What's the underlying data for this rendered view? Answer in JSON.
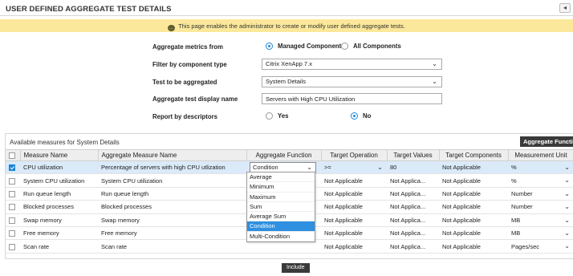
{
  "header": {
    "title": "USER DEFINED AGGREGATE TEST DETAILS",
    "back_glyph": "◂"
  },
  "info": {
    "message": "This page enables the administrator to create or modify user defined aggregate tests."
  },
  "form": {
    "metrics_label": "Aggregate metrics from",
    "metrics_options": [
      "Managed Components",
      "All Components"
    ],
    "metrics_selected": "Managed Components",
    "filter_label": "Filter by component type",
    "filter_value": "Citrix XenApp 7.x",
    "test_label": "Test to be aggregated",
    "test_value": "System Details",
    "display_name_label": "Aggregate test display name",
    "display_name_value": "Servers with High CPU Utilization",
    "descriptors_label": "Report by descriptors",
    "descriptors_options": [
      "Yes",
      "No"
    ],
    "descriptors_selected": "No"
  },
  "panel": {
    "title": "Available measures for System Details",
    "agg_button": "Aggregate Functi",
    "columns": [
      "Measure Name",
      "Aggregate Measure Name",
      "Aggregate Function",
      "Target Operation",
      "Target Values",
      "Target Components",
      "Measurement Unit"
    ],
    "rows": [
      {
        "checked": true,
        "measure": "CPU utilization",
        "agg_measure": "Percentage of servers with high CPU utlization",
        "function": "Condition",
        "operation": ">=",
        "target": "80",
        "components": "Not Applicable",
        "unit": "%"
      },
      {
        "checked": false,
        "measure": "System CPU utilization",
        "agg_measure": "System CPU utilization",
        "function": "",
        "operation": "Not Applicable",
        "target": "Not Applica...",
        "components": "Not Applicable",
        "unit": "%"
      },
      {
        "checked": false,
        "measure": "Run queue length",
        "agg_measure": "Run queue length",
        "function": "",
        "operation": "Not Applicable",
        "target": "Not Applica...",
        "components": "Not Applicable",
        "unit": "Number"
      },
      {
        "checked": false,
        "measure": "Blocked processes",
        "agg_measure": "Blocked processes",
        "function": "",
        "operation": "Not Applicable",
        "target": "Not Applica...",
        "components": "Not Applicable",
        "unit": "Number"
      },
      {
        "checked": false,
        "measure": "Swap memory",
        "agg_measure": "Swap memory",
        "function": "",
        "operation": "Not Applicable",
        "target": "Not Applica...",
        "components": "Not Applicable",
        "unit": "MB"
      },
      {
        "checked": false,
        "measure": "Free memory",
        "agg_measure": "Free memory",
        "function": "",
        "operation": "Not Applicable",
        "target": "Not Applica...",
        "components": "Not Applicable",
        "unit": "MB"
      },
      {
        "checked": false,
        "measure": "Scan rate",
        "agg_measure": "Scan rate",
        "function": "",
        "operation": "Not Applicable",
        "target": "Not Applica...",
        "components": "Not Applicable",
        "unit": "Pages/sec"
      }
    ]
  },
  "function_dropdown": {
    "options": [
      "Average",
      "Minimum",
      "Maximum",
      "Sum",
      "Average Sum",
      "Condition",
      "Multi-Condition"
    ],
    "highlighted": "Condition"
  },
  "include_button": "Include",
  "colors": {
    "info_bar": "#fbe89a",
    "selection": "#dbeaf9",
    "accent": "#1a86d6",
    "dark_button": "#3a3a3a"
  }
}
